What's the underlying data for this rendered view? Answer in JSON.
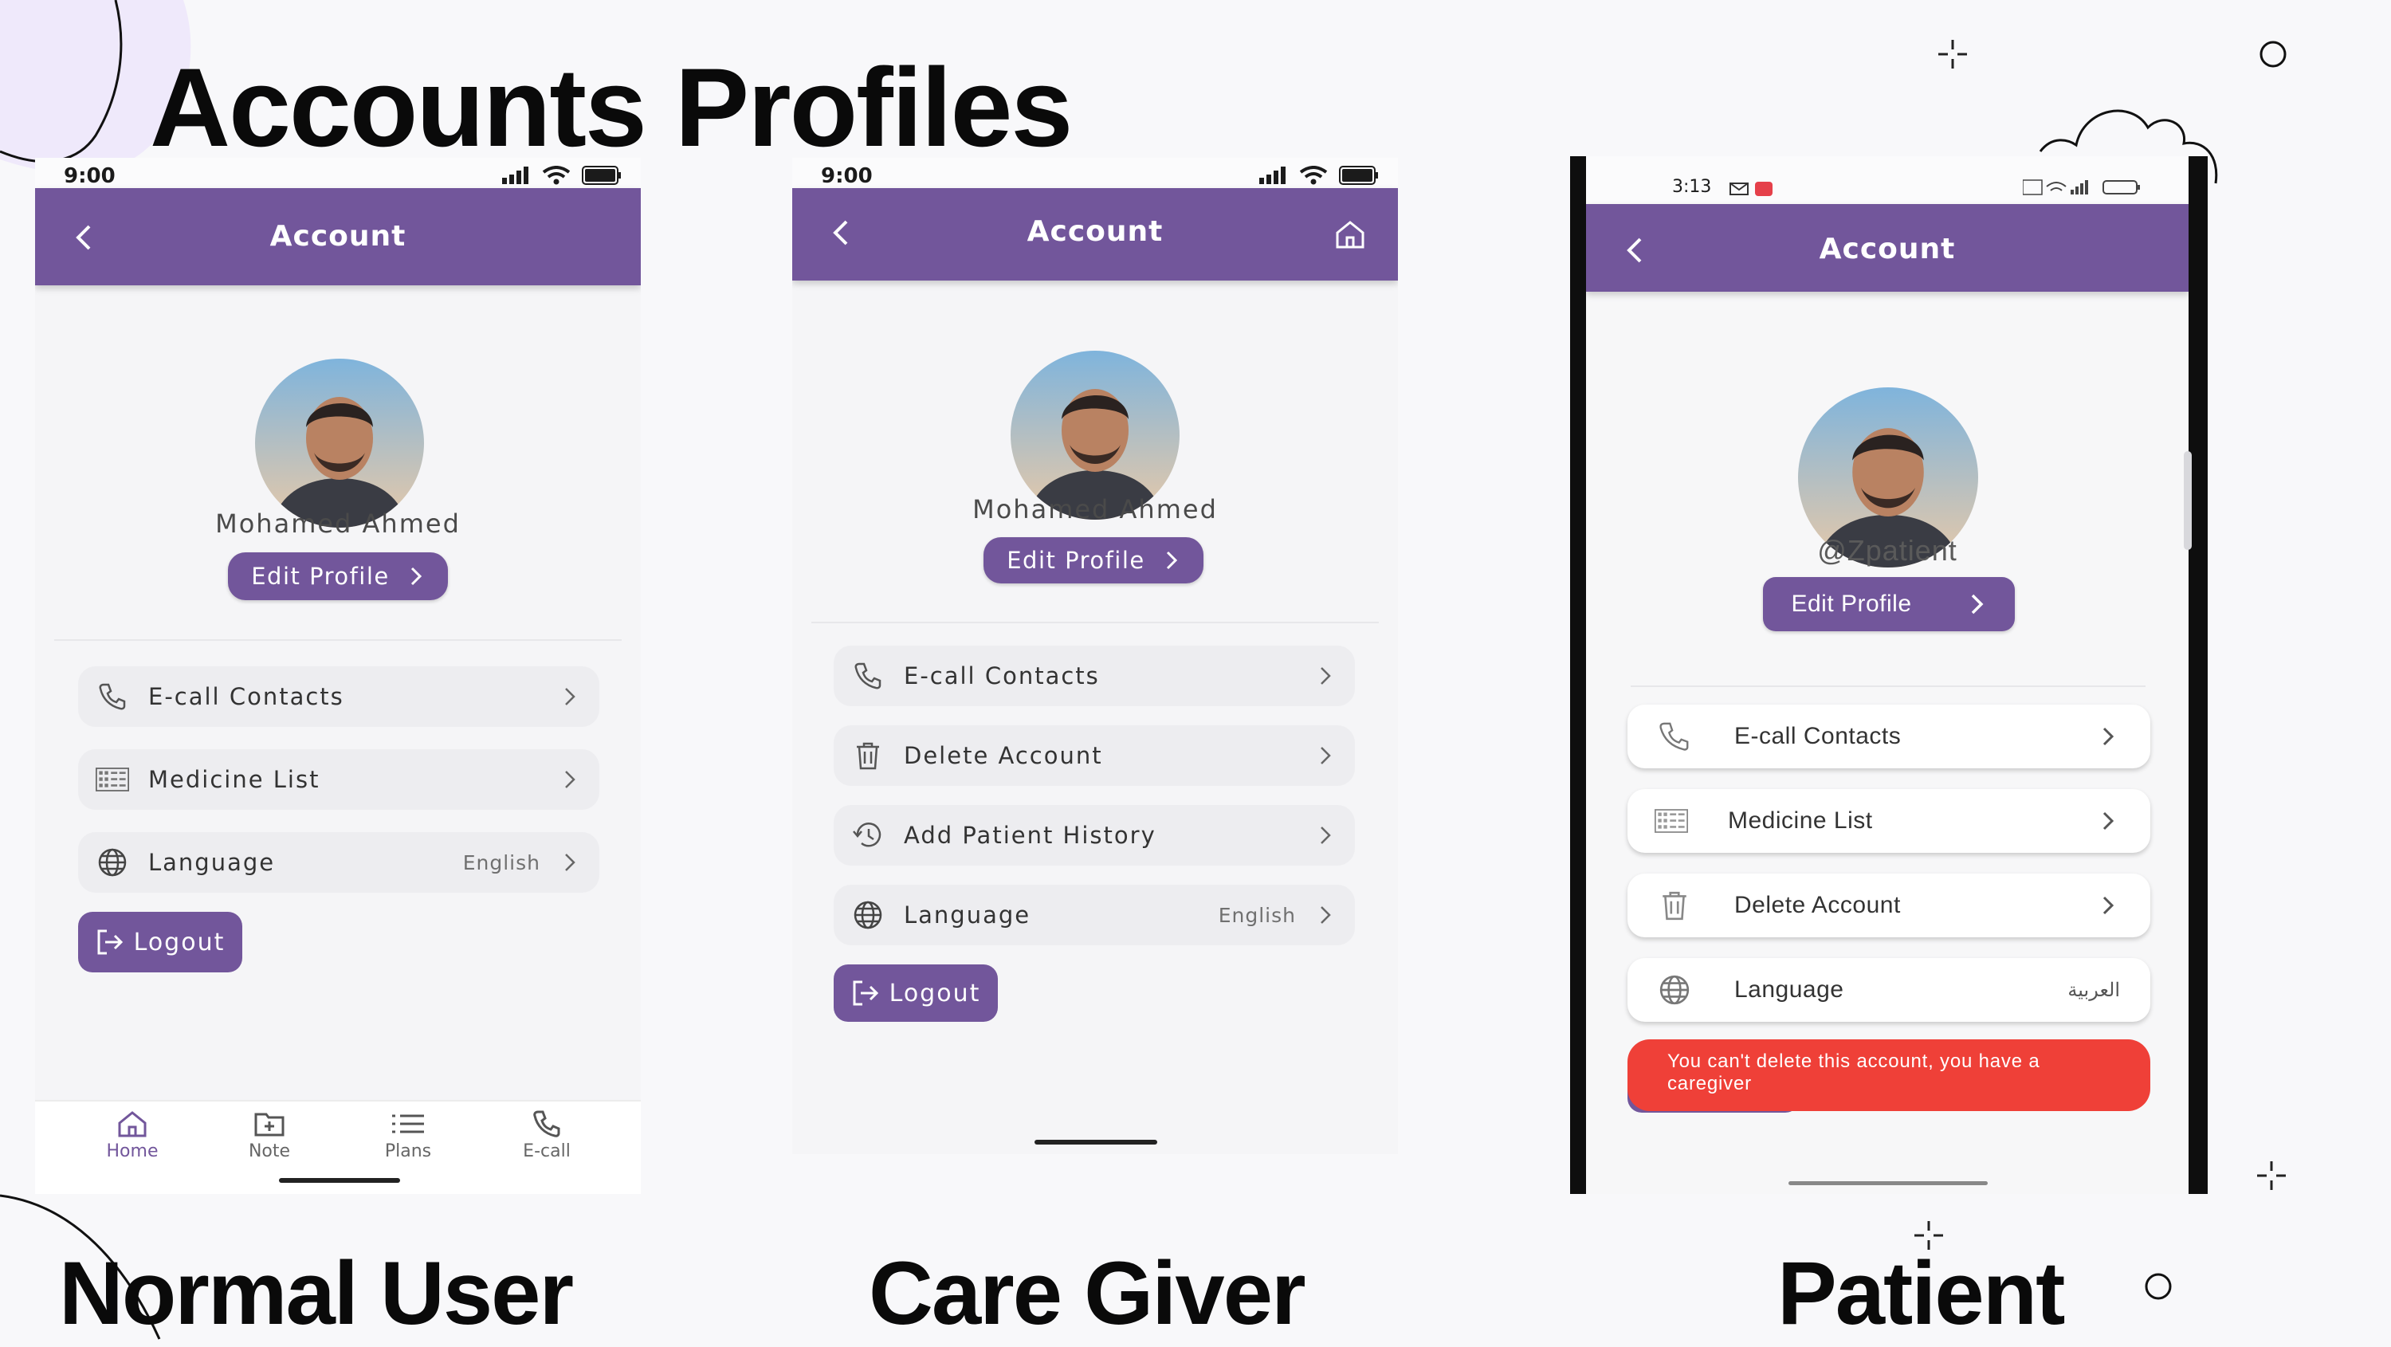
{
  "page_title": "Accounts Profiles",
  "sections": {
    "normal": "Normal User",
    "caregiver": "Care Giver",
    "patient": "Patient"
  },
  "colors": {
    "appbar": "#72569b",
    "background": "#f8f8fa",
    "error_toast": "#ef4038"
  },
  "normal_user": {
    "status_time": "9:00",
    "appbar_title": "Account",
    "user_name": "Mohamed Ahmed",
    "edit_profile": "Edit Profile",
    "menu": [
      {
        "label": "E-call Contacts",
        "icon": "phone-icon"
      },
      {
        "label": "Medicine List",
        "icon": "grid-list-icon"
      },
      {
        "label": "Language",
        "icon": "globe-icon",
        "value": "English"
      }
    ],
    "logout": "Logout",
    "nav": [
      {
        "label": "Home",
        "icon": "home-icon"
      },
      {
        "label": "Note",
        "icon": "note-icon"
      },
      {
        "label": "Plans",
        "icon": "list-icon"
      },
      {
        "label": "E-call",
        "icon": "phone-icon"
      }
    ]
  },
  "caregiver": {
    "status_time": "9:00",
    "appbar_title": "Account",
    "user_name": "Mohamed Ahmed",
    "edit_profile": "Edit Profile",
    "menu": [
      {
        "label": "E-call Contacts",
        "icon": "phone-icon"
      },
      {
        "label": "Delete Account",
        "icon": "trash-icon"
      },
      {
        "label": "Add Patient History",
        "icon": "history-icon"
      },
      {
        "label": "Language",
        "icon": "globe-icon",
        "value": "English"
      }
    ],
    "logout": "Logout"
  },
  "patient": {
    "status_time": "3:13",
    "appbar_title": "Account",
    "user_name": "@Zpatient",
    "edit_profile": "Edit Profile",
    "menu": [
      {
        "label": "E-call Contacts",
        "icon": "phone-icon"
      },
      {
        "label": "Medicine List",
        "icon": "grid-list-icon"
      },
      {
        "label": "Delete Account",
        "icon": "trash-icon"
      },
      {
        "label": "Language",
        "icon": "globe-icon",
        "value": "العربية"
      }
    ],
    "toast": "You can't delete this account, you have a caregiver"
  }
}
